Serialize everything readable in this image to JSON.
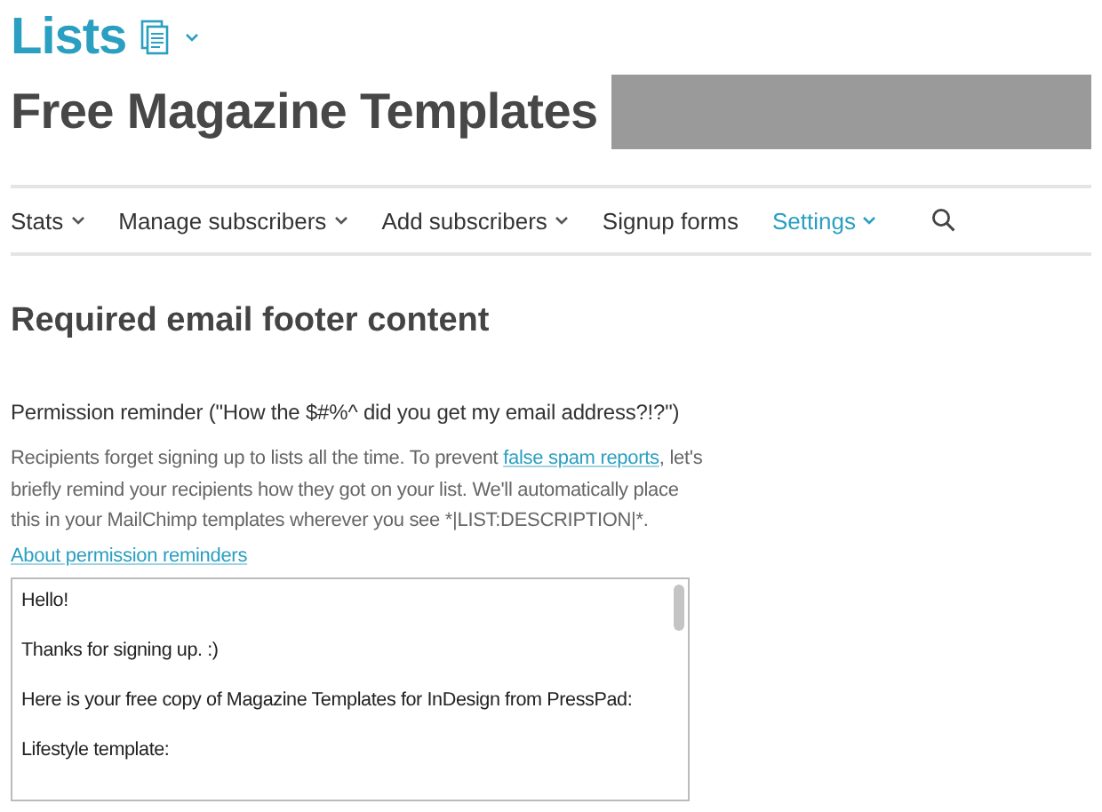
{
  "header": {
    "section": "Lists",
    "list_name": "Free Magazine Templates"
  },
  "nav": [
    {
      "label": "Stats",
      "has_menu": true,
      "selected": false
    },
    {
      "label": "Manage subscribers",
      "has_menu": true,
      "selected": false
    },
    {
      "label": "Add subscribers",
      "has_menu": true,
      "selected": false
    },
    {
      "label": "Signup forms",
      "has_menu": false,
      "selected": false
    },
    {
      "label": "Settings",
      "has_menu": true,
      "selected": true
    }
  ],
  "heading": "Required email footer content",
  "field_label": "Permission reminder (\"How the $#%^ did you get my email address?!?\")",
  "description": {
    "before": "Recipients forget signing up to lists all the time. To prevent ",
    "link": "false spam reports",
    "after": ", let's briefly remind your recipients how they got on your list. We'll automatically place this in your MailChimp templates wherever you see *|LIST:DESCRIPTION|*."
  },
  "help_link": "About permission reminders",
  "reminder_lines": [
    "Hello!",
    "Thanks for signing up. :)",
    "Here is your free copy of Magazine Templates for InDesign from PressPad:",
    "Lifestyle template:"
  ]
}
